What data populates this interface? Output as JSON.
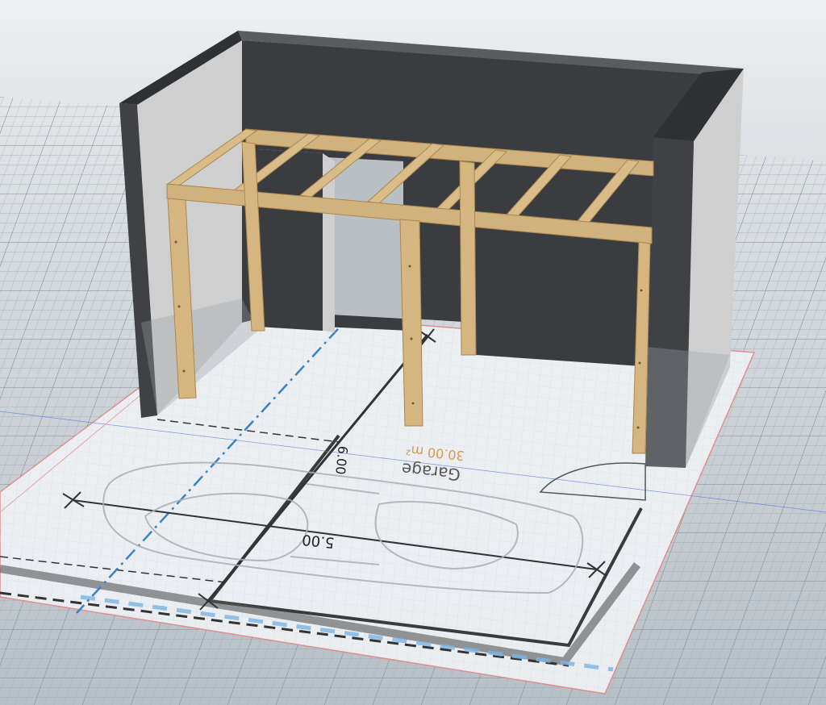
{
  "viewport": {
    "background_top": "#e9ecef",
    "background_bottom": "#bfc6cc",
    "grid_color": "#8f9aa3",
    "grid_minor_color": "#a8b1b8"
  },
  "floor_plan": {
    "room_name": "Garage",
    "room_area": "30.00 m²",
    "width_dimension": "5.00",
    "depth_dimension": "6.00",
    "sheet_color": "#eef1f4",
    "sheet_border_color": "#e28a8a",
    "axis_color": "#3b82c4",
    "area_color": "#d79a4e",
    "dimension_color": "#333333"
  },
  "model": {
    "wall_light": "#c9c9c9",
    "wall_dark": "#3a3c3f",
    "wall_top": "#d8d8d8",
    "timber_color": "#d2b27c",
    "timber_dark": "#a98751"
  }
}
